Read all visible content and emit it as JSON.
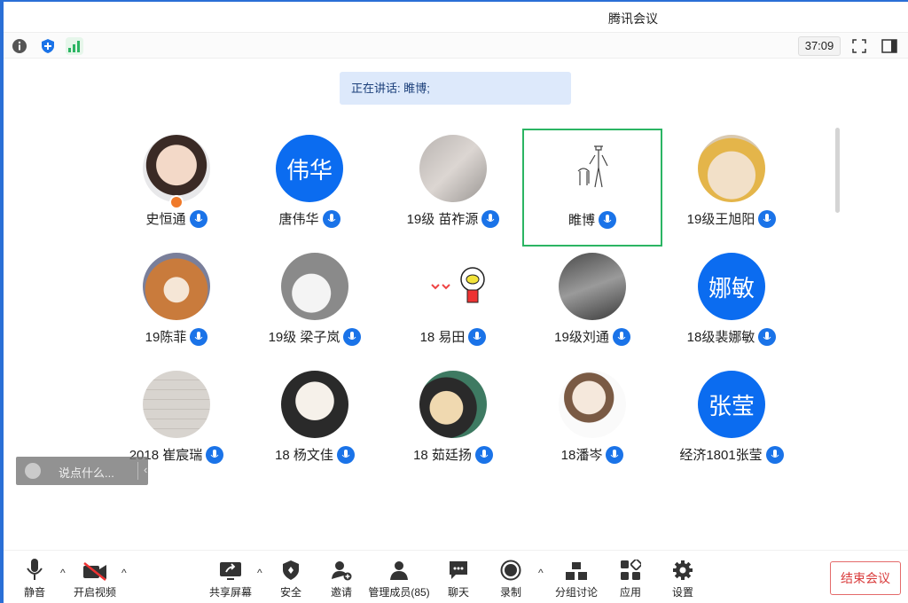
{
  "window": {
    "title": "腾讯会议"
  },
  "top_bar": {
    "timer": "37:09",
    "icons": [
      "info-icon",
      "shield-icon",
      "signal-icon"
    ],
    "right_icons": [
      "fullscreen-icon",
      "sidebar-toggle-icon"
    ]
  },
  "speaking": {
    "text": "正在讲话: 睢博;"
  },
  "participants": [
    {
      "name": "史恒通",
      "avatar": "photo",
      "host": true
    },
    {
      "name": "唐伟华",
      "avatar": "text",
      "avatar_text": "伟华"
    },
    {
      "name": "19级 苗祚源",
      "avatar": "photo"
    },
    {
      "name": "睢博",
      "avatar": "sketch",
      "active": true
    },
    {
      "name": "19级王旭阳",
      "avatar": "photo"
    },
    {
      "name": "19陈菲",
      "avatar": "photo"
    },
    {
      "name": "19级 梁子岚",
      "avatar": "photo"
    },
    {
      "name": "18 易田",
      "avatar": "photo"
    },
    {
      "name": "19级刘通",
      "avatar": "photo"
    },
    {
      "name": "18级裴娜敏",
      "avatar": "text",
      "avatar_text": "娜敏"
    },
    {
      "name": "2018 崔宸瑞",
      "avatar": "photo"
    },
    {
      "name": "18 杨文佳",
      "avatar": "photo"
    },
    {
      "name": "18 茹廷扬",
      "avatar": "photo"
    },
    {
      "name": "18潘岑",
      "avatar": "photo"
    },
    {
      "name": "经济1801张莹",
      "avatar": "text",
      "avatar_text": "张莹"
    }
  ],
  "chat_float": {
    "placeholder": "说点什么...",
    "caret": "‹"
  },
  "toolbar": {
    "mute": "静音",
    "video": "开启视频",
    "share": "共享屏幕",
    "security": "安全",
    "invite": "邀请",
    "members": "管理成员(85)",
    "chat": "聊天",
    "record": "录制",
    "breakout": "分组讨论",
    "apps": "应用",
    "settings": "设置",
    "end": "结束会议"
  },
  "colors": {
    "accent": "#0b6cf0",
    "active_border": "#2bb563",
    "end_red": "#d93b3b"
  }
}
